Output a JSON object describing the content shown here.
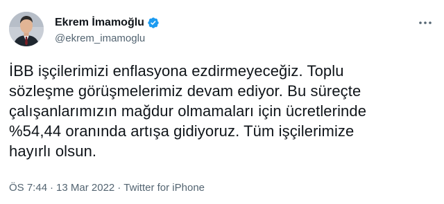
{
  "tweet": {
    "author": {
      "name": "Ekrem İmamoğlu",
      "handle": "@ekrem_imamoglu",
      "verified": true,
      "avatar_icon": "user-avatar-icon"
    },
    "body_lines": [
      "İBB işçilerimizi enflasyona ezdirmeyeceğiz. Toplu",
      "sözleşme görüşmelerimiz devam ediyor. Bu süreçte",
      "çalışanlarımızın mağdur olmamaları için ücretlerinde",
      "%54,44 oranında artışa gidiyoruz. Tüm işçilerimize",
      "hayırlı olsun."
    ],
    "meta": {
      "time": "ÖS 7:44",
      "separator": "·",
      "date": "13 Mar 2022",
      "source": "Twitter for iPhone"
    },
    "more_icon": "more-options-icon"
  },
  "colors": {
    "text_primary": "#0f1419",
    "text_secondary": "#536471",
    "verified_blue": "#1d9bf0"
  }
}
